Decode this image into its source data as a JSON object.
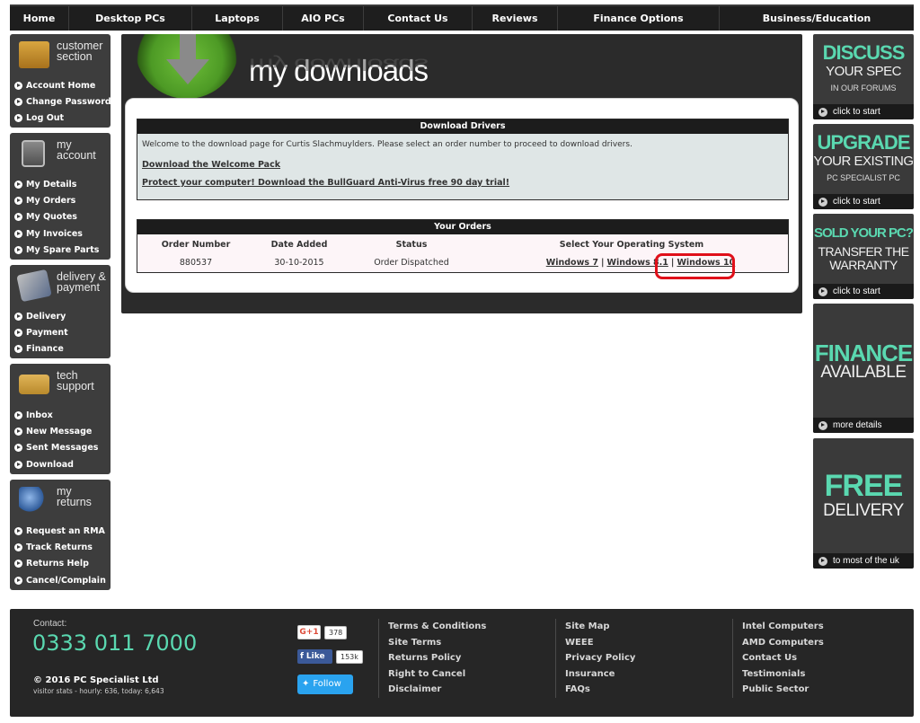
{
  "nav": {
    "items": [
      "Home",
      "Desktop PCs",
      "Laptops",
      "AIO PCs",
      "Contact Us",
      "Reviews",
      "Finance Options",
      "Business/Education"
    ]
  },
  "sidebar": {
    "customer": {
      "title_line1": "customer",
      "title_line2": "section",
      "links": [
        "Account Home",
        "Change Password",
        "Log Out"
      ]
    },
    "account": {
      "title_line1": "my",
      "title_line2": "account",
      "links": [
        "My Details",
        "My Orders",
        "My Quotes",
        "My Invoices",
        "My Spare Parts"
      ]
    },
    "delivery": {
      "title_line1": "delivery &",
      "title_line2": "payment",
      "links": [
        "Delivery",
        "Payment",
        "Finance"
      ]
    },
    "support": {
      "title_line1": "tech",
      "title_line2": "support",
      "links": [
        "Inbox",
        "New Message",
        "Sent Messages",
        "Download"
      ]
    },
    "returns": {
      "title_line1": "my",
      "title_line2": "returns",
      "links": [
        "Request an RMA",
        "Track Returns",
        "Returns Help",
        "Cancel/Complain"
      ]
    }
  },
  "main": {
    "title": "my downloads",
    "drivers": {
      "header": "Download Drivers",
      "intro": "Welcome to the download page for Curtis Slachmuylders. Please select an order number to proceed to download drivers.",
      "welcome_pack": "Download the Welcome Pack",
      "bullguard": "Protect your computer! Download the BullGuard Anti-Virus free 90 day trial!"
    },
    "orders": {
      "header": "Your Orders",
      "columns": [
        "Order Number",
        "Date Added",
        "Status",
        "Select Your Operating System"
      ],
      "rows": [
        {
          "order_number": "880537",
          "date_added": "30-10-2015",
          "status": "Order Dispatched",
          "os_links": [
            "Windows 7",
            "Windows 8.1",
            "Windows 10"
          ],
          "separator": "|"
        }
      ]
    }
  },
  "banners": {
    "discuss": {
      "big": "DISCUSS",
      "mid": "YOUR SPEC",
      "small": "IN OUR FORUMS",
      "cta": "click to start"
    },
    "upgrade": {
      "big": "UPGRADE",
      "mid": "YOUR EXISTING",
      "small": "PC SPECIALIST PC",
      "cta": "click to start"
    },
    "sold": {
      "big": "SOLD YOUR PC?",
      "mid1": "TRANSFER THE",
      "mid2": "WARRANTY",
      "cta": "click to start"
    },
    "finance": {
      "big": "FINANCE",
      "mid": "AVAILABLE",
      "cta": "more details"
    },
    "delivery": {
      "big": "FREE",
      "mid": "DELIVERY",
      "cta": "to most of the uk"
    }
  },
  "footer": {
    "contact_label": "Contact:",
    "phone": "0333 011 7000",
    "copyright": "© 2016 PC Specialist Ltd",
    "stats": "visitor stats - hourly: 636, today: 6,643",
    "social": {
      "gplus_label": "G+1",
      "gplus_count": "378",
      "fb_label": "Like",
      "fb_count": "153k",
      "tw_label": "Follow"
    },
    "col1": [
      "Terms & Conditions",
      "Site Terms",
      "Returns Policy",
      "Right to Cancel",
      "Disclaimer"
    ],
    "col2": [
      "Site Map",
      "WEEE",
      "Privacy Policy",
      "Insurance",
      "FAQs"
    ],
    "col3": [
      "Intel Computers",
      "AMD Computers",
      "Contact Us",
      "Testimonials",
      "Public Sector"
    ]
  },
  "colors": {
    "accent": "#5ad8b0",
    "highlight": "#e0101a",
    "panel": "#3d3d3d",
    "nav": "#1e1e1e"
  }
}
